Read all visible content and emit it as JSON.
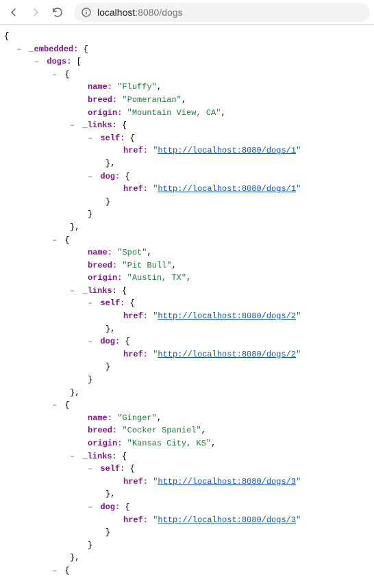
{
  "toolbar": {
    "url_host": "localhost",
    "url_port": ":8080",
    "url_path": "/dogs"
  },
  "json": {
    "embedded_key": "_embedded",
    "dogs_key": "dogs",
    "name_key": "name",
    "breed_key": "breed",
    "origin_key": "origin",
    "links_key": "_links",
    "self_key": "self",
    "dog_key": "dog",
    "href_key": "href",
    "dogs": [
      {
        "name": "Fluffy",
        "breed": "Pomeranian",
        "origin": "Mountain View, CA",
        "self_href": "http://localhost:8080/dogs/1",
        "dog_href": "http://localhost:8080/dogs/1"
      },
      {
        "name": "Spot",
        "breed": "Pit Bull",
        "origin": "Austin, TX",
        "self_href": "http://localhost:8080/dogs/2",
        "dog_href": "http://localhost:8080/dogs/2"
      },
      {
        "name": "Ginger",
        "breed": "Cocker Spaniel",
        "origin": "Kansas City, KS",
        "self_href": "http://localhost:8080/dogs/3",
        "dog_href": "http://localhost:8080/dogs/3"
      }
    ]
  }
}
